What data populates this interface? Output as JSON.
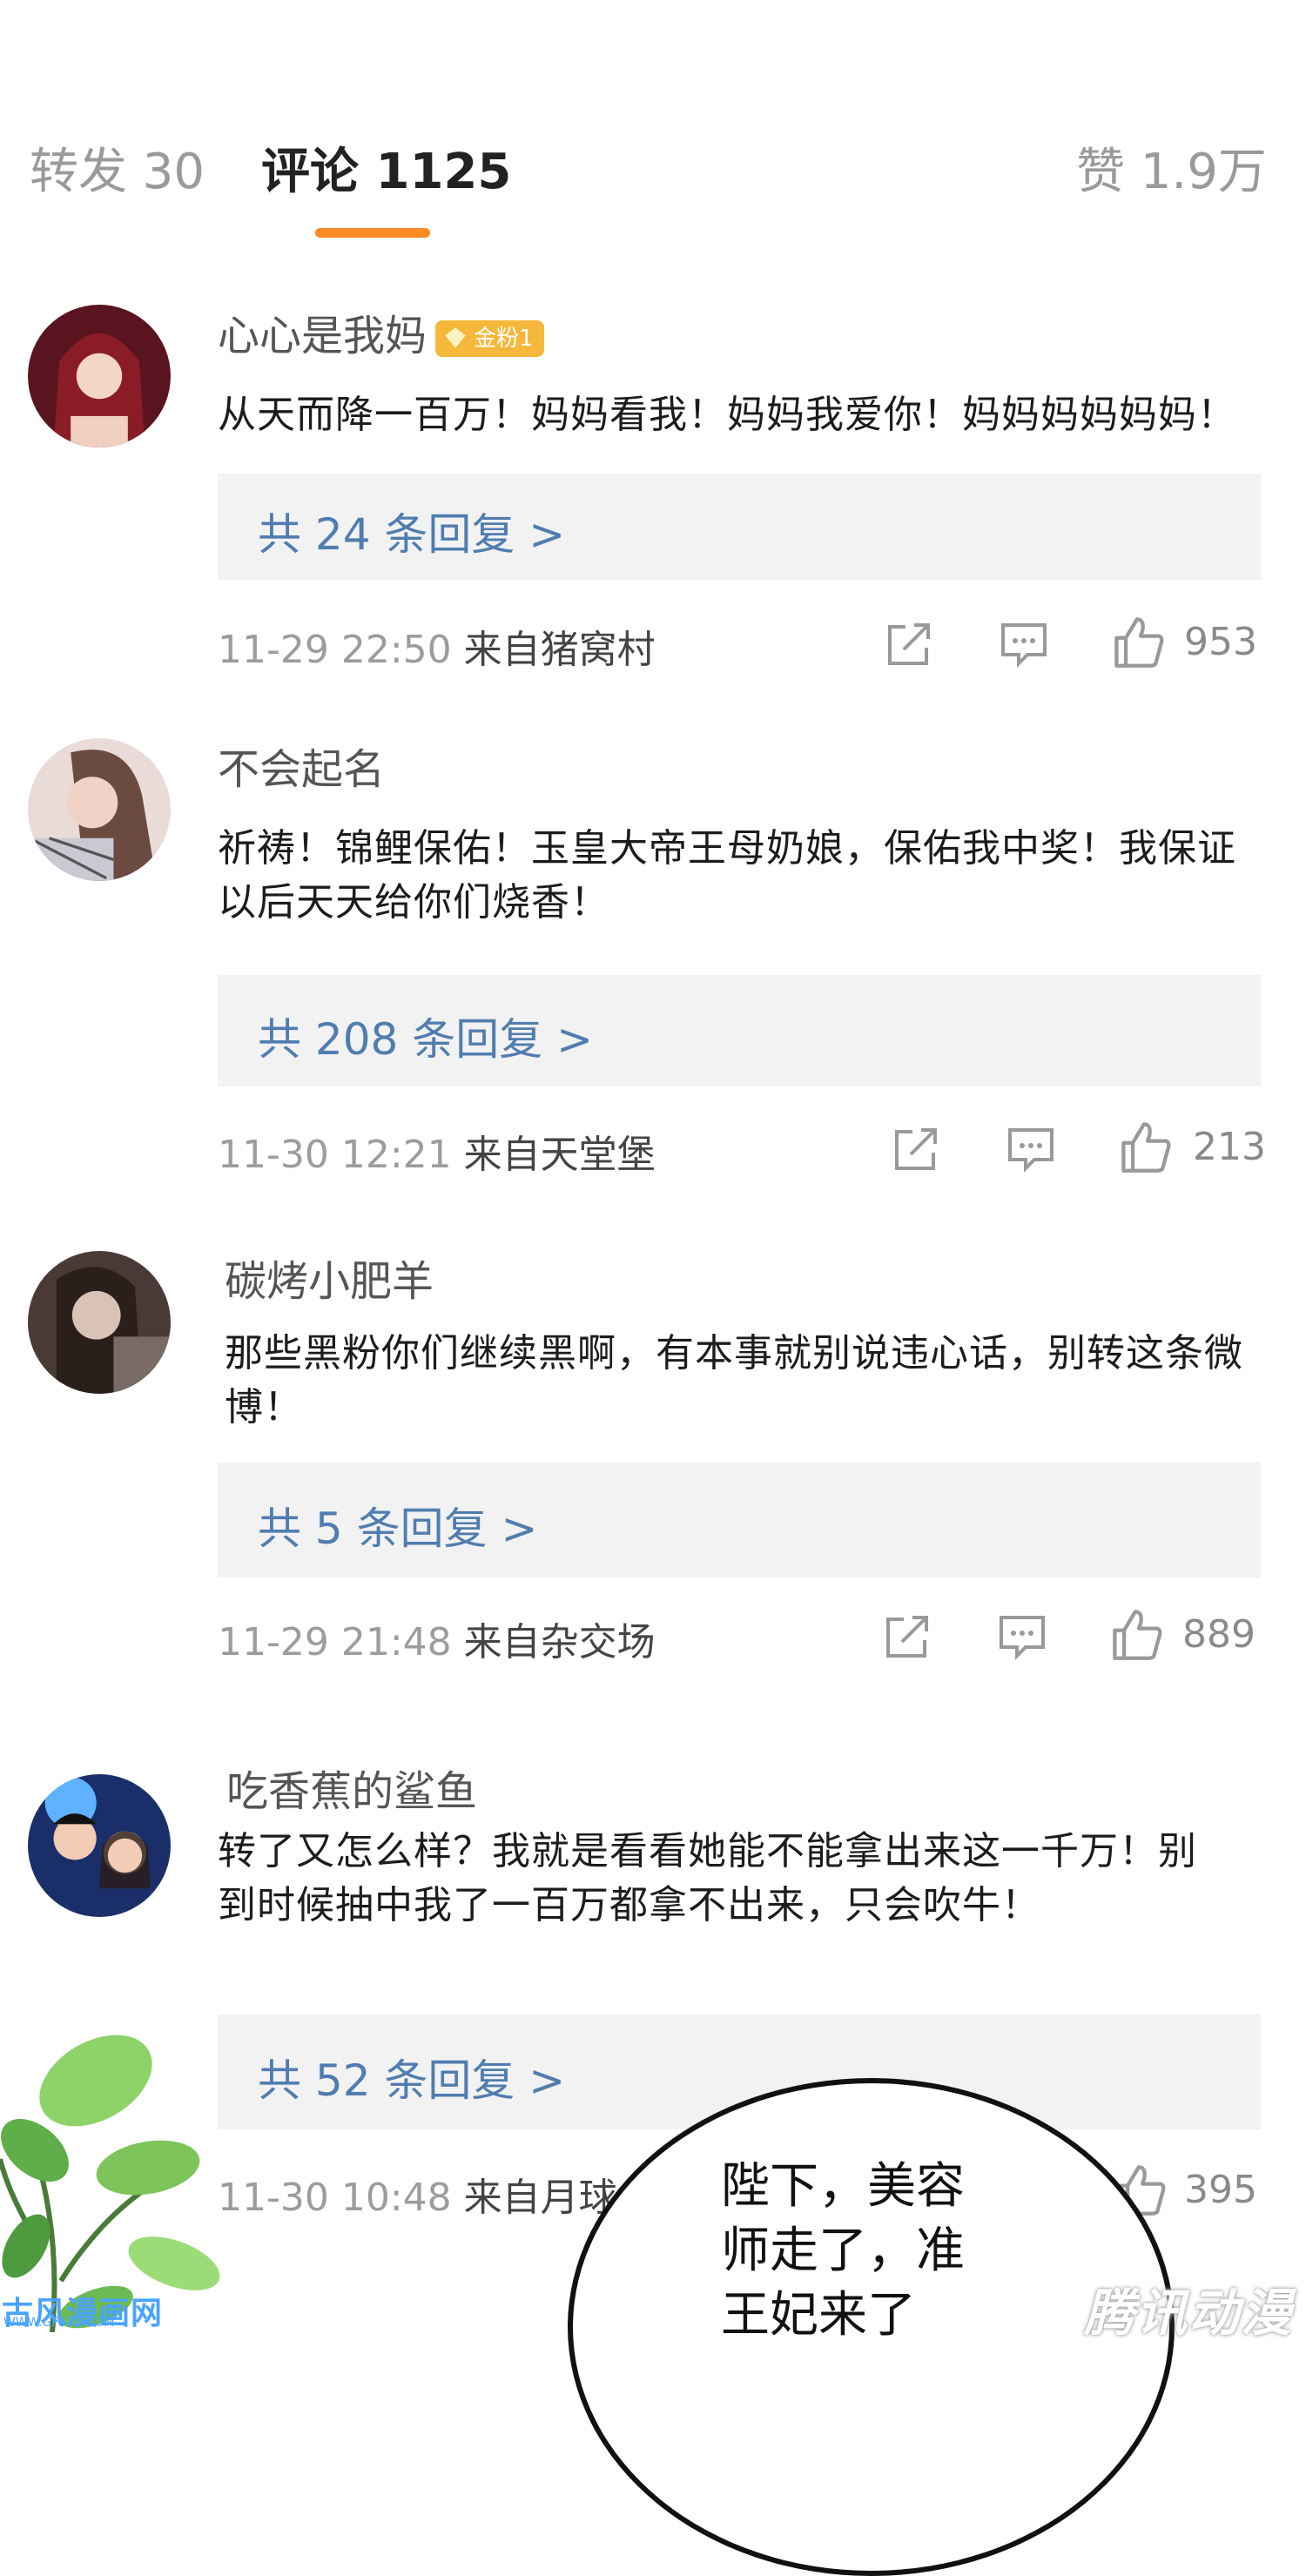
{
  "tabs": {
    "repost": "转发 30",
    "comments": "评论 1125",
    "likes": "赞 1.9万"
  },
  "comments": [
    {
      "username": "心心是我妈",
      "badge": "金粉1",
      "text": "从天而降一百万！妈妈看我！妈妈我爱你！妈妈妈妈妈妈！",
      "replies": "共 24 条回复 >",
      "time": "11-29 22:50",
      "source": "来自猪窝村",
      "like_count": "953"
    },
    {
      "username": "不会起名",
      "text": "祈祷！锦鲤保佑！玉皇大帝王母奶娘，保佑我中奖！我保证以后天天给你们烧香！",
      "replies": "共 208 条回复 >",
      "time": "11-30 12:21",
      "source": "来自天堂堡",
      "like_count": "213"
    },
    {
      "username": "碳烤小肥羊",
      "text": "那些黑粉你们继续黑啊，有本事就别说违心话，别转这条微博！",
      "replies": "共 5 条回复 >",
      "time": "11-29 21:48",
      "source": "来自杂交场",
      "like_count": "889"
    },
    {
      "username": "吃香蕉的鲨鱼",
      "text": "转了又怎么样？我就是看看她能不能拿出来这一千万！别到时候抽中我了一百万都拿不出来，只会吹牛！",
      "replies": "共 52 条回复 >",
      "time": "11-30 10:48",
      "source": "来自月球",
      "like_count": "395"
    }
  ],
  "speech_bubble": "陛下，美容师走了，准王妃来了",
  "watermarks": {
    "left": "古风漫画网",
    "left_url": "WWW.GF618.COM",
    "right": "腾讯动漫"
  },
  "colors": {
    "accent": "#ff8a23",
    "link": "#507daf",
    "badge": "#f5b83a",
    "reply_bg": "#f2f2f2"
  },
  "icons": [
    "share-icon",
    "comment-icon",
    "thumbs-up-icon",
    "avatar"
  ]
}
